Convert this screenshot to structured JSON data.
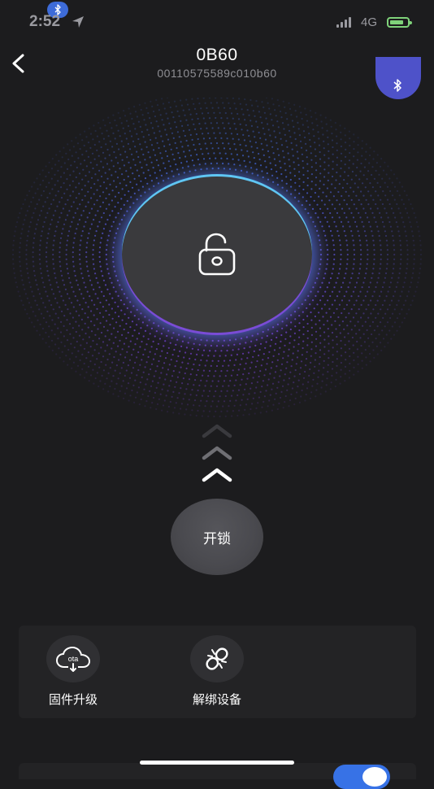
{
  "status_bar": {
    "time": "2:52",
    "network": "4G",
    "bluetooth_badge_icon": "bluetooth-icon",
    "location_icon": "location-arrow-icon",
    "battery_color": "#7fd27a"
  },
  "header": {
    "back_icon": "chevron-left-icon",
    "title": "0B60",
    "device_id": "00110575589c010b60",
    "bluetooth_fab_icon": "bluetooth-icon",
    "fab_color": "#4e52c9"
  },
  "lock": {
    "icon": "unlocked-padlock-icon",
    "ring_top_color": "#5fc6f3",
    "ring_bottom_color": "#7a4cd6"
  },
  "swipe_hint": {
    "icon": "chevron-up-icon"
  },
  "unlock_button": {
    "label": "开锁"
  },
  "actions": [
    {
      "icon": "cloud-ota-download-icon",
      "icon_text": "ota",
      "label": "固件升级"
    },
    {
      "icon": "unlink-icon",
      "label": "解绑设备"
    }
  ],
  "accent_toggle_color": "#3772e6"
}
